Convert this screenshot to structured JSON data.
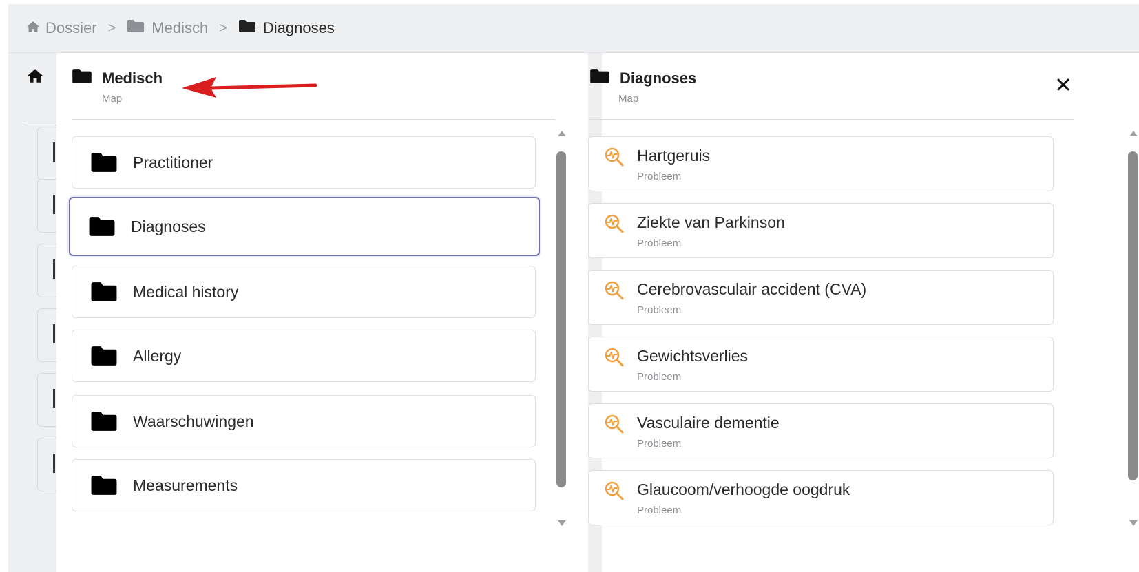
{
  "breadcrumb": {
    "items": [
      {
        "label": "Dossier"
      },
      {
        "label": "Medisch"
      },
      {
        "label": "Diagnoses"
      }
    ],
    "separator": ">"
  },
  "left_panel": {
    "title": "Medisch",
    "subtitle": "Map",
    "items": [
      {
        "label": "Practitioner"
      },
      {
        "label": "Diagnoses",
        "selected": true
      },
      {
        "label": "Medical history"
      },
      {
        "label": "Allergy"
      },
      {
        "label": "Waarschuwingen"
      },
      {
        "label": "Measurements"
      }
    ]
  },
  "right_panel": {
    "title": "Diagnoses",
    "subtitle": "Map",
    "items": [
      {
        "title": "Hartgeruis",
        "type": "Probleem"
      },
      {
        "title": "Ziekte van Parkinson",
        "type": "Probleem"
      },
      {
        "title": "Cerebrovasculair accident (CVA)",
        "type": "Probleem"
      },
      {
        "title": "Gewichtsverlies",
        "type": "Probleem"
      },
      {
        "title": "Vasculaire dementie",
        "type": "Probleem"
      },
      {
        "title": "Glaucoom/verhoogde oogdruk",
        "type": "Probleem"
      }
    ]
  },
  "colors": {
    "accent_border": "#6e6fa6",
    "problem_icon": "#f0a040",
    "annotation_arrow": "#d81e1e"
  },
  "icons": {
    "home": "home-icon",
    "folder": "folder-icon",
    "problem": "magnifier-pulse-icon",
    "close": "close-icon"
  }
}
